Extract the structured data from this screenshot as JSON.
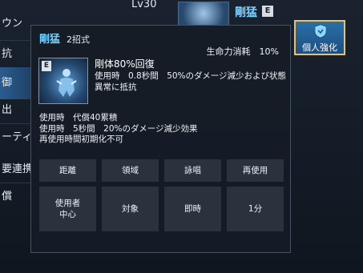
{
  "left_menu": [
    {
      "label": "ウン",
      "active": false
    },
    {
      "label": "抗",
      "active": false
    },
    {
      "label": "御",
      "active": true
    },
    {
      "label": "出",
      "active": false
    },
    {
      "label": "ーティー",
      "active": false
    },
    {
      "label": "要連携",
      "active": false
    },
    {
      "label": "償",
      "active": false
    }
  ],
  "header": {
    "level": "Lv30",
    "character_name": "剛猛",
    "grade_badge": "E"
  },
  "personal_button": {
    "label": "個人強化",
    "icon": "shield-icon"
  },
  "tooltip": {
    "skill_name": "剛猛",
    "skill_type": "2招式",
    "cost": "生命力消耗　10%",
    "icon_badge": "E",
    "effect_title": "剛体80%回復",
    "effect_desc": "使用時　0.8秒間　50%のダメージ減少および状態異常に抵抗",
    "effect2_lines": [
      "使用時　代償40累積",
      "使用時　5秒間　20%のダメージ減少効果",
      "再使用時間初期化不可"
    ],
    "stats": [
      {
        "header": "距離",
        "value": "使用者\n中心"
      },
      {
        "header": "領域",
        "value": "対象"
      },
      {
        "header": "詠唱",
        "value": "即時"
      },
      {
        "header": "再使用",
        "value": "1分"
      }
    ]
  },
  "colors": {
    "accent": "#6fd0ff",
    "panel_bg": "#161c26",
    "cell_bg": "#2a323e",
    "button_border": "#f0c060"
  }
}
